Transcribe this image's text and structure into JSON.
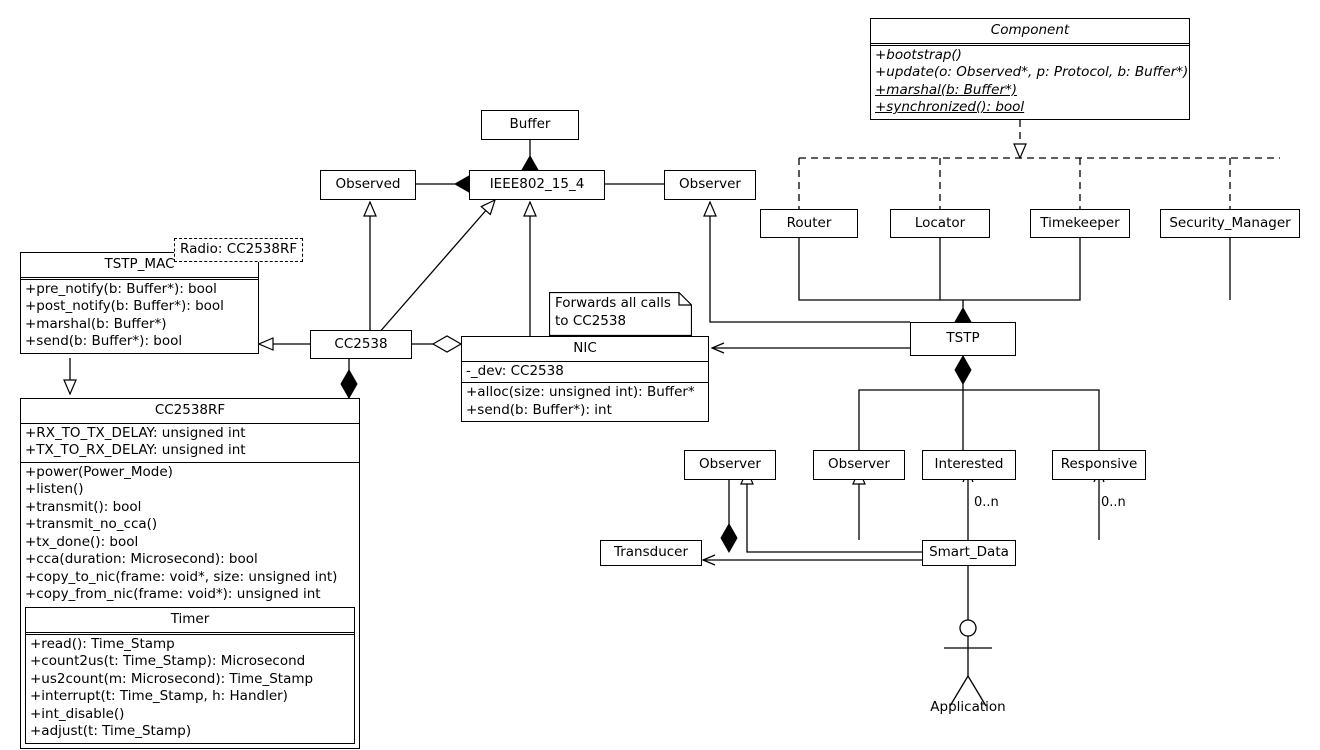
{
  "diagram": {
    "kind": "uml-class-diagram",
    "stroke_color": "#000000",
    "fill_color": "#ffffff"
  },
  "classes": {
    "component": {
      "name": "Component",
      "operations": [
        "+bootstrap()",
        "+update(o: Observed*, p: Protocol, b: Buffer*)",
        "+marshal(b: Buffer*)",
        "+synchronized(): bool"
      ]
    },
    "buffer": {
      "name": "Buffer"
    },
    "observed_top": {
      "name": "Observed"
    },
    "ieee": {
      "name": "IEEE802_15_4"
    },
    "observer_top": {
      "name": "Observer"
    },
    "router": {
      "name": "Router"
    },
    "locator": {
      "name": "Locator"
    },
    "timekeeper": {
      "name": "Timekeeper"
    },
    "security_manager": {
      "name": "Security_Manager"
    },
    "tstp_mac": {
      "name": "TSTP_MAC",
      "binding": "Radio: CC2538RF",
      "operations": [
        "+pre_notify(b: Buffer*): bool",
        "+post_notify(b: Buffer*): bool",
        "+marshal(b: Buffer*)",
        "+send(b: Buffer*): bool"
      ]
    },
    "cc2538": {
      "name": "CC2538"
    },
    "nic": {
      "name": "NIC",
      "attributes": [
        "-_dev: CC2538"
      ],
      "operations": [
        "+alloc(size: unsigned int): Buffer*",
        "+send(b: Buffer*): int"
      ]
    },
    "tstp": {
      "name": "TSTP"
    },
    "cc2538rf": {
      "name": "CC2538RF",
      "attributes": [
        "+RX_TO_TX_DELAY: unsigned int",
        "+TX_TO_RX_DELAY: unsigned int"
      ],
      "operations": [
        "+power(Power_Mode)",
        "+listen()",
        "+transmit(): bool",
        "+transmit_no_cca()",
        "+tx_done(): bool",
        "+cca(duration: Microsecond): bool",
        "+copy_to_nic(frame: void*, size: unsigned int)",
        "+copy_from_nic(frame: void*): unsigned int"
      ],
      "nested": {
        "name": "Timer",
        "operations": [
          "+read(): Time_Stamp",
          "+count2us(t: Time_Stamp): Microsecond",
          "+us2count(m: Microsecond): Time_Stamp",
          "+interrupt(t: Time_Stamp, h: Handler)",
          "+int_disable()",
          "+adjust(t: Time_Stamp)"
        ]
      }
    },
    "observer_transducer": {
      "name": "Observer"
    },
    "observer_smartdata": {
      "name": "Observer"
    },
    "interested": {
      "name": "Interested"
    },
    "responsive": {
      "name": "Responsive"
    },
    "transducer": {
      "name": "Transducer"
    },
    "smart_data": {
      "name": "Smart_Data"
    },
    "application": {
      "name": "Application"
    }
  },
  "notes": {
    "nic_note": {
      "text": "Forwards all calls\nto CC2538"
    }
  },
  "multiplicities": {
    "interested_smartdata": "0..n",
    "responsive_smartdata": "0..n"
  }
}
